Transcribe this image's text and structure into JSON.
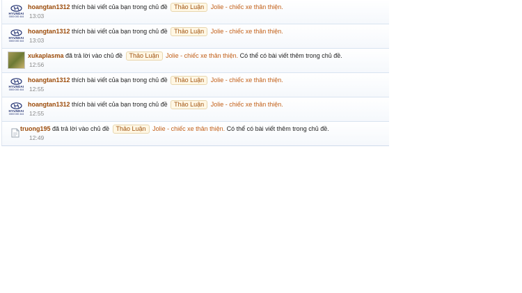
{
  "notifications": [
    {
      "avatar": "hyundai-logo",
      "user": "hoangtan1312",
      "action": "thích bài viết của bạn trong chủ đề",
      "tag": "Thảo Luận",
      "thread": "Jolie - chiếc xe thân thiện.",
      "suffix": "",
      "time": "13:03"
    },
    {
      "avatar": "hyundai-logo",
      "user": "hoangtan1312",
      "action": "thích bài viết của bạn trong chủ đề",
      "tag": "Thảo Luận",
      "thread": "Jolie - chiếc xe thân thiện.",
      "suffix": "",
      "time": "13:03"
    },
    {
      "avatar": "photo",
      "user": "xukaplasma",
      "action": "đã trả lời vào chủ đề",
      "tag": "Thảo Luận",
      "thread": "Jolie - chiếc xe thân thiện.",
      "suffix": "Có thể có bài viết thêm trong chủ đề.",
      "time": "12:56"
    },
    {
      "avatar": "hyundai-logo",
      "user": "hoangtan1312",
      "action": "thích bài viết của bạn trong chủ đề",
      "tag": "Thảo Luận",
      "thread": "Jolie - chiếc xe thân thiện.",
      "suffix": "",
      "time": "12:55"
    },
    {
      "avatar": "hyundai-logo",
      "user": "hoangtan1312",
      "action": "thích bài viết của bạn trong chủ đề",
      "tag": "Thảo Luận",
      "thread": "Jolie - chiếc xe thân thiện.",
      "suffix": "",
      "time": "12:55"
    },
    {
      "avatar": "broken-image",
      "user": "truong195",
      "action": "đã trả lời vào chủ đề",
      "tag": "Thảo Luận",
      "thread": "Jolie - chiếc xe thân thiện.",
      "suffix": "Có thể có bài viết thêm trong chủ đề.",
      "time": "12:49"
    }
  ],
  "hyundai": {
    "word": "HYUNDAI",
    "phone": "0000 000 444"
  },
  "colors": {
    "username": "#9b4a08",
    "thread": "#c25f17",
    "tag_bg": "#fff7e4"
  }
}
